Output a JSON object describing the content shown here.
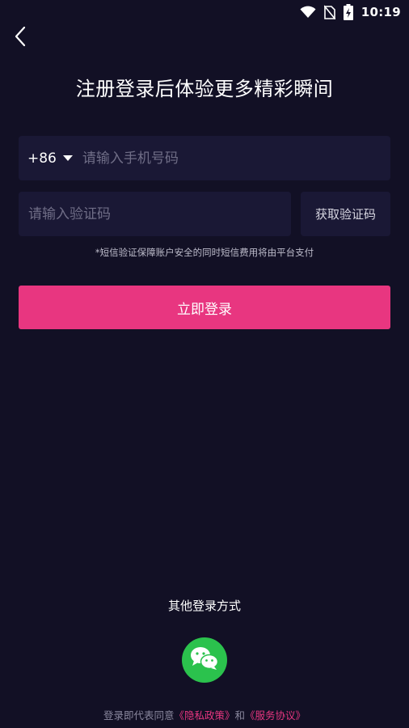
{
  "status_bar": {
    "time": "10:19",
    "icons": [
      "wifi-icon",
      "no-sim-icon",
      "battery-charging-icon"
    ]
  },
  "nav": {
    "back_icon": "chevron-left-icon"
  },
  "title": "注册登录后体验更多精彩瞬间",
  "phone": {
    "country_code": "+86",
    "placeholder": "请输入手机号码",
    "value": ""
  },
  "verification": {
    "placeholder": "请输入验证码",
    "value": "",
    "get_code_label": "获取验证码"
  },
  "sms_notice": "*短信验证保障账户安全的同时短信费用将由平台支付",
  "login_button_label": "立即登录",
  "other_login": {
    "label": "其他登录方式",
    "options": [
      "wechat-icon"
    ]
  },
  "agreement": {
    "prefix": "登录即代表同意",
    "privacy_link": "《隐私政策》",
    "conjunction": "和",
    "service_link": "《服务协议》"
  },
  "colors": {
    "background": "#121025",
    "field_background": "#1a1835",
    "accent": "#e83680",
    "wechat_green": "#2bc24d"
  }
}
